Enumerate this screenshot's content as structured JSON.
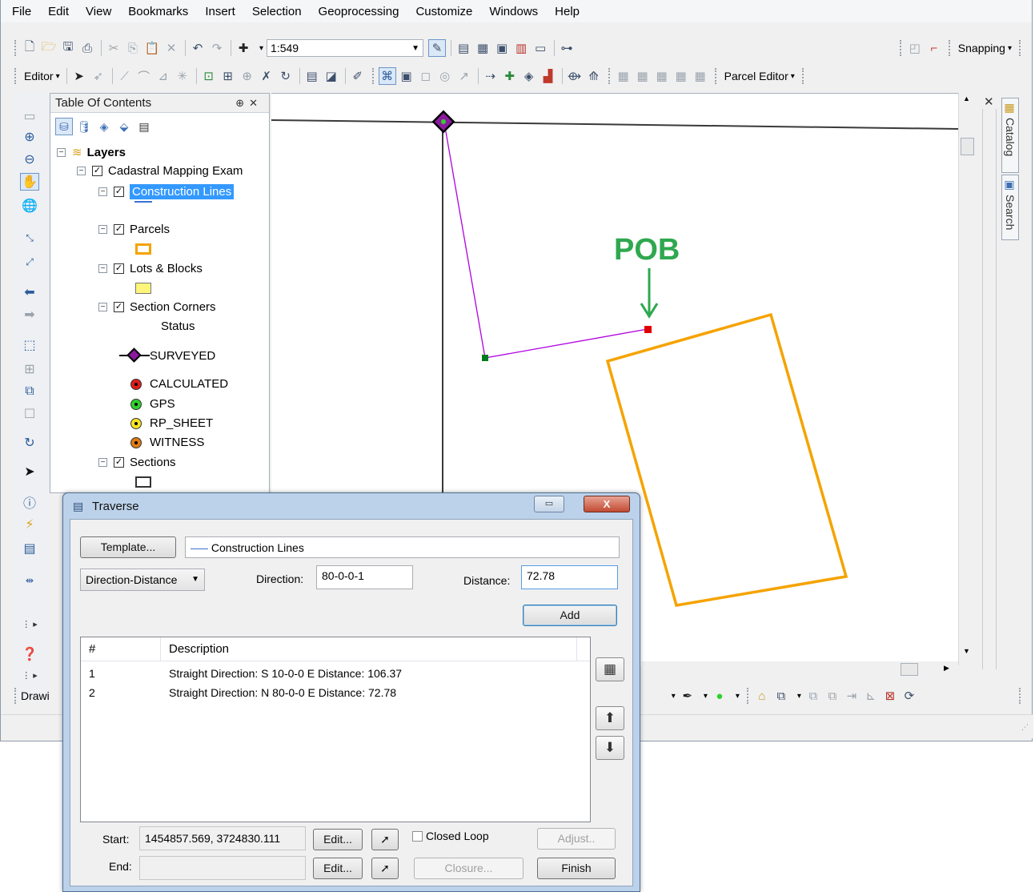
{
  "menu": [
    "File",
    "Edit",
    "View",
    "Bookmarks",
    "Insert",
    "Selection",
    "Geoprocessing",
    "Customize",
    "Windows",
    "Help"
  ],
  "toolbar": {
    "scale": "1:549",
    "snapping": "Snapping",
    "editor": "Editor",
    "parcel_editor": "Parcel Editor",
    "drawing": "Drawi"
  },
  "toc": {
    "title": "Table Of Contents",
    "pin": "⊕ ✕",
    "layers": "Layers",
    "dataframe": "Cadastral Mapping Exam",
    "construction_lines": "Construction Lines",
    "parcels": "Parcels",
    "lots_blocks": "Lots & Blocks",
    "section_corners": "Section Corners",
    "status": "Status",
    "surveyed": "SURVEYED",
    "calculated": "CALCULATED",
    "gps": "GPS",
    "rp_sheet": "RP_SHEET",
    "witness": "WITNESS",
    "sections": "Sections"
  },
  "map": {
    "pob_label": "POB",
    "colors": {
      "traverse_line": "#b000e0",
      "parcel_outline": "#f5a300",
      "pob_text": "#2fa84f",
      "pob_point": "#e00000",
      "end_point": "#007a1f"
    }
  },
  "dock": {
    "catalog": "Catalog",
    "search": "Search"
  },
  "dialog": {
    "title": "Traverse",
    "template_button": "Template...",
    "template_value": "Construction Lines",
    "mode": "Direction-Distance",
    "direction_label": "Direction:",
    "direction_value": "80-0-0-1",
    "distance_label": "Distance:",
    "distance_value": "72.78",
    "add_button": "Add",
    "columns": [
      "#",
      "Description"
    ],
    "rows": [
      {
        "num": "1",
        "desc": "Straight  Direction: S 10-0-0 E  Distance: 106.37"
      },
      {
        "num": "2",
        "desc": "Straight  Direction: N 80-0-0 E  Distance: 72.78"
      }
    ],
    "start_label": "Start:",
    "start_value": "1454857.569,  3724830.111",
    "end_label": "End:",
    "end_value": "",
    "edit_button": "Edit...",
    "closed_loop": "Closed Loop",
    "adjust_button": "Adjust..",
    "closure_button": "Closure...",
    "finish_button": "Finish",
    "close_glyph": "X"
  }
}
